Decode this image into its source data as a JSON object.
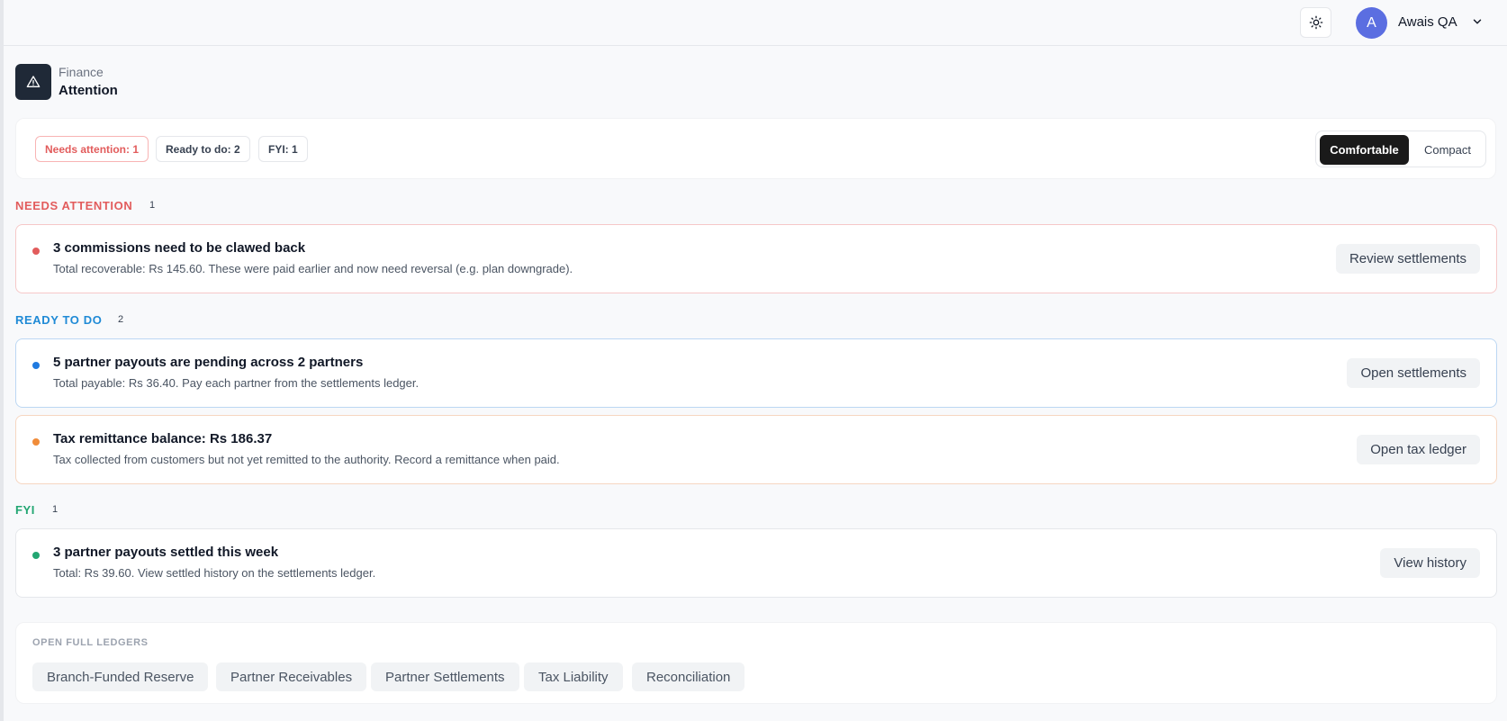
{
  "topbar": {
    "user_initial": "A",
    "user_name": "Awais QA"
  },
  "header": {
    "section": "Finance",
    "title": "Attention"
  },
  "filters": {
    "needs_attention": "Needs attention: 1",
    "ready_to_do": "Ready to do: 2",
    "fyi": "FYI: 1",
    "density_comfortable": "Comfortable",
    "density_compact": "Compact"
  },
  "sections": {
    "needs_attention": {
      "label": "NEEDS ATTENTION",
      "count": "1",
      "color": "#e25c5c"
    },
    "ready_to_do": {
      "label": "READY TO DO",
      "count": "2",
      "color": "#1f8ad6"
    },
    "fyi": {
      "label": "FYI",
      "count": "1",
      "color": "#22a672"
    }
  },
  "cards": {
    "clawback": {
      "title": "3 commissions need to be clawed back",
      "description": "Total recoverable: Rs 145.60. These were paid earlier and now need reversal (e.g. plan downgrade).",
      "action": "Review settlements",
      "dot_color": "#e25c5c"
    },
    "payouts_pending": {
      "title": "5 partner payouts are pending across 2 partners",
      "description": "Total payable: Rs 36.40. Pay each partner from the settlements ledger.",
      "action": "Open settlements",
      "dot_color": "#1f7ae0"
    },
    "tax_remittance": {
      "title": "Tax remittance balance: Rs 186.37",
      "description": "Tax collected from customers but not yet remitted to the authority. Record a remittance when paid.",
      "action": "Open tax ledger",
      "dot_color": "#f08c3a"
    },
    "payouts_settled": {
      "title": "3 partner payouts settled this week",
      "description": "Total: Rs 39.60. View settled history on the settlements ledger.",
      "action": "View history",
      "dot_color": "#22a672"
    }
  },
  "ledgers": {
    "heading": "OPEN FULL LEDGERS",
    "items": [
      "Branch-Funded Reserve",
      "Partner Receivables",
      "Partner Settlements",
      "Tax Liability",
      "Reconciliation"
    ]
  }
}
